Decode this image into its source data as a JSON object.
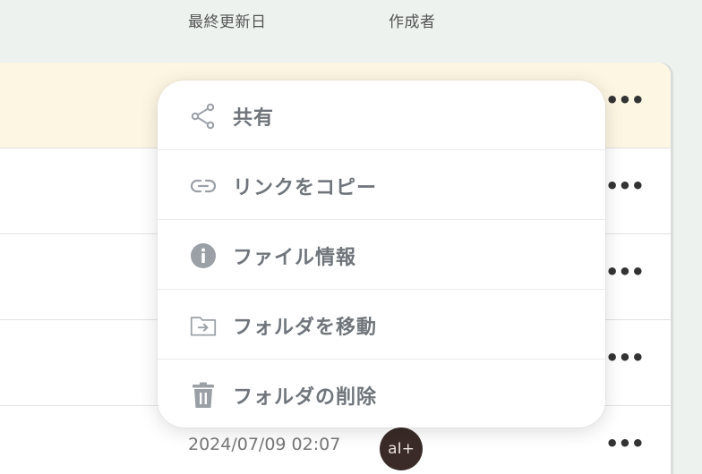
{
  "columns": {
    "last_updated": "最終更新日",
    "author": "作成者"
  },
  "rows": [
    {
      "more_label": "•••"
    },
    {
      "more_label": "•••"
    },
    {
      "more_label": "•••"
    },
    {
      "more_label": "•••"
    },
    {
      "date": "2024/07/09 02:07",
      "avatar_text": "aI+",
      "more_label": "•••"
    }
  ],
  "context_menu": {
    "items": [
      {
        "label": "共有",
        "icon": "share-icon"
      },
      {
        "label": "リンクをコピー",
        "icon": "link-icon"
      },
      {
        "label": "ファイル情報",
        "icon": "info-icon"
      },
      {
        "label": "フォルダを移動",
        "icon": "move-folder-icon"
      },
      {
        "label": "フォルダの削除",
        "icon": "trash-icon"
      }
    ]
  },
  "colors": {
    "highlight_row": "#fdf6e3",
    "menu_text": "#6f757b",
    "icon": "#9aa0a6"
  }
}
